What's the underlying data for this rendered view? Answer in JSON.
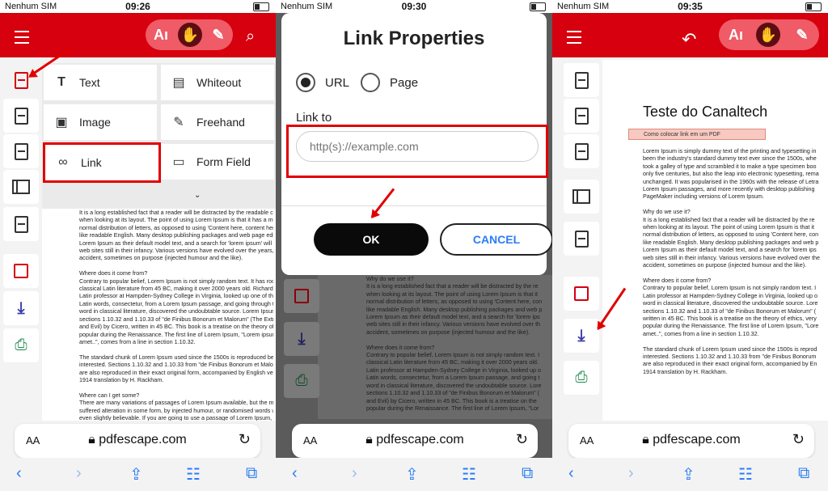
{
  "status": [
    {
      "carrier": "Nenhum SIM",
      "time": "09:26"
    },
    {
      "carrier": "Nenhum SIM",
      "time": "09:30"
    },
    {
      "carrier": "Nenhum SIM",
      "time": "09:35"
    }
  ],
  "browser": {
    "aa": "AA",
    "url": "pdfescape.com"
  },
  "menu": {
    "items": [
      {
        "label": "Text",
        "icon": "text-T-icon"
      },
      {
        "label": "Whiteout",
        "icon": "paint-roller-icon"
      },
      {
        "label": "Image",
        "icon": "image-icon"
      },
      {
        "label": "Freehand",
        "icon": "pencil-icon"
      },
      {
        "label": "Link",
        "icon": "link-icon"
      },
      {
        "label": "Form Field",
        "icon": "form-field-icon"
      }
    ]
  },
  "dialog": {
    "title": "Link Properties",
    "option_url": "URL",
    "option_page": "Page",
    "link_to_label": "Link to",
    "link_placeholder": "http(s)://example.com",
    "ok_label": "OK",
    "cancel_label": "CANCEL"
  },
  "document": {
    "title": "Teste do Canaltech",
    "annotation": "Como colocar link em um PDF",
    "p1_lines": "Lorem Ipsum is simply dummy text of the printing and typesetting in\nbeen the industry's standard dummy text ever since the 1500s, whe\ntook a galley of type and scrambled it to make a type specimen boo\nonly five centuries, but also the leap into electronic typesetting, rema\nunchanged. It was popularised in the 1960s with the release of Letra\nLorem Ipsum passages, and more recently with desktop publishing\nPageMaker including versions of Lorem Ipsum.\n\nWhy do we use it?\nIt is a long established fact that a reader will be distracted by the re\nwhen looking at its layout. The point of using Lorem Ipsum is that it\nnormal distribution of letters, as opposed to using 'Content here, con\nlike readable English. Many desktop publishing packages and web p\nLorem Ipsum as their default model text, and a search for 'lorem ips\nweb sites still in their infancy. Various versions have evolved over the\naccident, sometimes on purpose (injected humour and the like).\n\nWhere does it come from?\nContrary to popular belief, Lorem Ipsum is not simply random text. I\nLatin professor at Hampden-Sydney College in Virginia, looked up o\nword in classical literature, discovered the undoubtable source. Lore\nsections 1.10.32 and 1.10.33 of \"de Finibus Bonorum et Malorum\" (\nwritten in 45 BC. This book is a treatise on the theory of ethics, very\npopular during the Renaissance. The first line of Lorem Ipsum, \"Lore\namet..\", comes from a line in section 1.10.32.\n\nThe standard chunk of Lorem Ipsum used since the 1500s is reprod\ninterested. Sections 1.10.32 and 1.10.33 from \"de Finibus Bonorum\nare also reproduced in their exact original form, accompanied by En\n1914 translation by H. Rackham.",
    "p0_lines": "It is a long established fact that a reader will be distracted by the readable cont\nwhen looking at its layout. The point of using Lorem Ipsum is that it has a more-\nnormal distribution of letters, as opposed to using 'Content here, content here', m\nlike readable English. Many desktop publishing packages and web page editors\nLorem Ipsum as their default model text, and a search for 'lorem ipsum' will unc\nweb sites still in their infancy. Various versions have evolved over the years, so\naccident, sometimes on purpose (injected humour and the like).\n\nWhere does it come from?\nContrary to popular belief, Lorem Ipsum is not simply random text. It has roots i\nclassical Latin literature from 45 BC, making it over 2000 years old. Richard Mc\nLatin professor at Hampden-Sydney College in Virginia, looked up one of the mor\nLatin words, consectetur, from a Lorem Ipsum passage, and going through the\nword in classical literature, discovered the undoubtable source. Lorem Ipsum c\nsections 1.10.32 and 1.10.33 of \"de Finibus Bonorum et Malorum\" (The Extrem\nand Evil) by Cicero, written in 45 BC. This book is a treatise on the theory of eth\npopular during the Renaissance. The first line of Lorem Ipsum, \"Lorem ipsum d\namet..\", comes from a line in section 1.10.32.\n\nThe standard chunk of Lorem Ipsum used since the 1500s is reproduced below\ninterested. Sections 1.10.32 and 1.10.33 from \"de Finibus Bonorum et Malorum\nare also reproduced in their exact original form, accompanied by English versio\n1914 translation by H. Rackham.\n\nWhere can I get some?\nThere are many variations of passages of Lorem Ipsum available, but the majo\nsuffered alteration in some form, by injected humour, or randomised words whic\neven slightly believable. If you are going to use a passage of Lorem Ipsum, you\nsure there isn't anything embarrassing hidden in the middle of text. All the Lorer",
    "p2_lines": "Why do we use it?\nIt is a long established fact that a reader will be distracted by the re\nwhen looking at its layout. The point of using Lorem Ipsum is that it\nnormal distribution of letters, as opposed to using 'Content here, con\nlike readable English. Many desktop publishing packages and web p\nLorem Ipsum as their default model text, and a search for 'lorem ips\nweb sites still in their infancy. Various versions have evolved over th\naccident, sometimes on purpose (injected humour and the like).\n\nWhere does it come from?\nContrary to popular belief, Lorem Ipsum is not simply random text. I\nclassical Latin literature from 45 BC, making it over 2000 years old.\nLatin professor at Hampden-Sydney College in Virginia, looked up o\nLatin words, consectetur, from a Lorem Ipsum passage, and going t\nword in classical literature, discovered the undoubtable source. Lore\nsections 1.10.32 and 1.10.33 of \"de Finibus Bonorum et Malorum\" (\nand Evil) by Cicero, written in 45 BC. This book is a treatise on the\npopular during the Renaissance. The first line of Lorem Ipsum, \"Lor"
  },
  "colors": {
    "brand_red": "#d6000f",
    "accent_blue": "#2a7cf6",
    "annotation_red": "#e00000"
  }
}
